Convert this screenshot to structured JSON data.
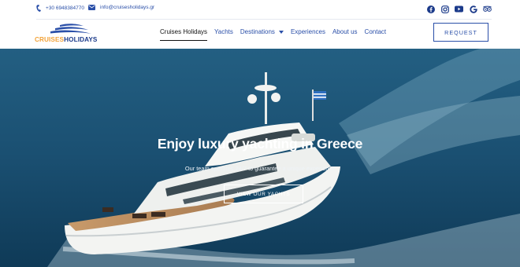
{
  "topbar": {
    "phone": "+30 6948384770",
    "email": "info@cruisesholidays.gr",
    "social_icons": [
      "facebook-icon",
      "instagram-icon",
      "youtube-icon",
      "google-icon",
      "tripadvisor-icon"
    ]
  },
  "logo": {
    "part1": "CRUISES",
    "part2": "HOLIDAYS"
  },
  "nav": {
    "items": [
      {
        "label": "Cruises Holidays",
        "active": true
      },
      {
        "label": "Yachts"
      },
      {
        "label": "Destinations",
        "dropdown": true
      },
      {
        "label": "Experiences"
      },
      {
        "label": "About us"
      },
      {
        "label": "Contact"
      }
    ]
  },
  "header": {
    "request_label": "REQUEST"
  },
  "hero": {
    "title": "Enjoy luxury yachting in Greece",
    "subtitle": "Our team operates 24/7 to guarantee a unique experience",
    "button_label": "VIEW OUR YACHTS"
  },
  "colors": {
    "brand_blue": "#2a4fa8",
    "brand_orange": "#f2a33a",
    "sea": "#1a4f71"
  }
}
